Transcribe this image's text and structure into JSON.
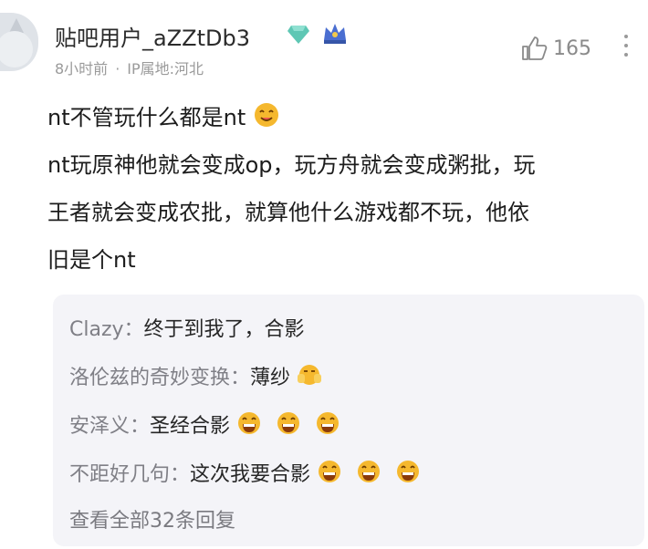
{
  "post": {
    "username": "贴吧用户_aZZtDb3",
    "time": "8小时前",
    "separator": "·",
    "ip_location": "IP属地:河北",
    "likes": "165",
    "lines": [
      "nt不管玩什么都是nt",
      "nt玩原神他就会变成op，玩方舟就会变成粥批，玩",
      "王者就会变成农批，就算他什么游戏都不玩，他依",
      "旧是个nt"
    ]
  },
  "replies": {
    "items": [
      {
        "nick": "Clazy",
        "colon": "：",
        "text": "终于到我了，合影",
        "emoji_count": 0
      },
      {
        "nick": "洛伦兹的奇妙变换",
        "colon": "：",
        "text": "薄纱",
        "emoji_count": 1
      },
      {
        "nick": "安泽义",
        "colon": "：",
        "text": "圣经合影",
        "emoji_count": 3
      },
      {
        "nick": "不距好几句",
        "colon": "：",
        "text": "这次我要合影",
        "emoji_count": 3
      }
    ],
    "view_all": "查看全部32条回复"
  },
  "colors": {
    "diamond": "#5ec7b4",
    "crown": "#4a6ed1",
    "emoji": "#f5b82e"
  },
  "icons": [
    "avatar",
    "diamond-badge-icon",
    "crown-badge-icon",
    "thumbs-up-icon",
    "more-icon",
    "emoji-icon"
  ]
}
